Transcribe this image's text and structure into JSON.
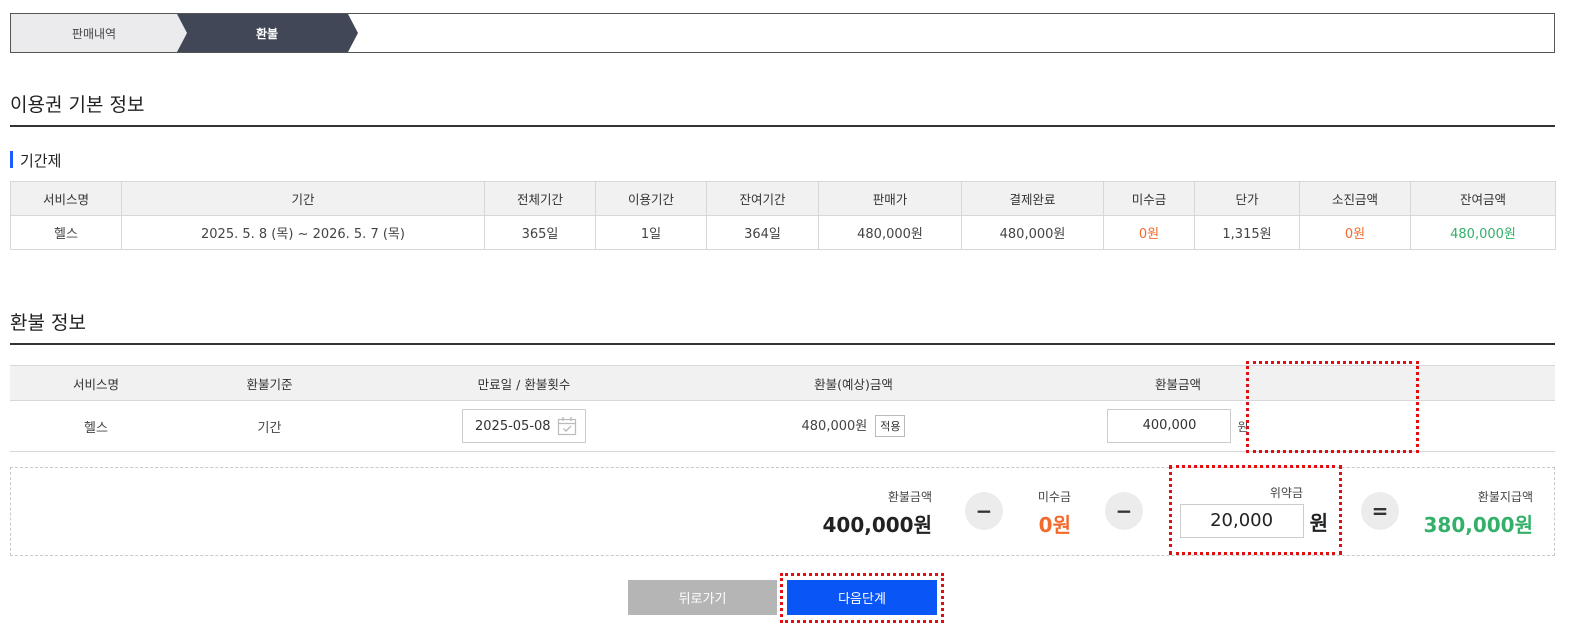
{
  "breadcrumb": {
    "items": [
      {
        "label": "판매내역"
      },
      {
        "label": "환불"
      }
    ]
  },
  "basic_info": {
    "title": "이용권 기본 정보",
    "subtitle": "기간제",
    "headers": [
      "서비스명",
      "기간",
      "전체기간",
      "이용기간",
      "잔여기간",
      "판매가",
      "결제완료",
      "미수금",
      "단가",
      "소진금액",
      "잔여금액"
    ],
    "row": {
      "service": "헬스",
      "period": "2025. 5. 8 (목) ~ 2026. 5. 7 (목)",
      "total_period": "365일",
      "used_period": "1일",
      "remaining_period": "364일",
      "sale_price": "480,000원",
      "paid": "480,000원",
      "unpaid": "0원",
      "unit_price": "1,315원",
      "consumed": "0원",
      "remaining_amount": "480,000원"
    }
  },
  "refund_info": {
    "title": "환불 정보",
    "headers": [
      "서비스명",
      "환불기준",
      "만료일 / 환불횟수",
      "환불(예상)금액",
      "환불금액"
    ],
    "row": {
      "service": "헬스",
      "basis": "기간",
      "expiry_date": "2025-05-08",
      "expected_amount": "480,000원",
      "apply_label": "적용",
      "refund_amount": "400,000",
      "won": "원"
    }
  },
  "calc": {
    "refund_label": "환불금액",
    "refund_value": "400,000원",
    "minus_symbol": "−",
    "unpaid_label": "미수금",
    "unpaid_value": "0원",
    "penalty_label": "위약금",
    "penalty_value": "20,000",
    "penalty_won": "원",
    "equals_symbol": "=",
    "payout_label": "환불지급액",
    "payout_value": "380,000원"
  },
  "buttons": {
    "back": "뒤로가기",
    "next": "다음단계"
  },
  "colors": {
    "accent_blue": "#0a55f5",
    "orange": "#f26a2c",
    "green": "#34b06a",
    "highlight_red": "#e01010"
  }
}
